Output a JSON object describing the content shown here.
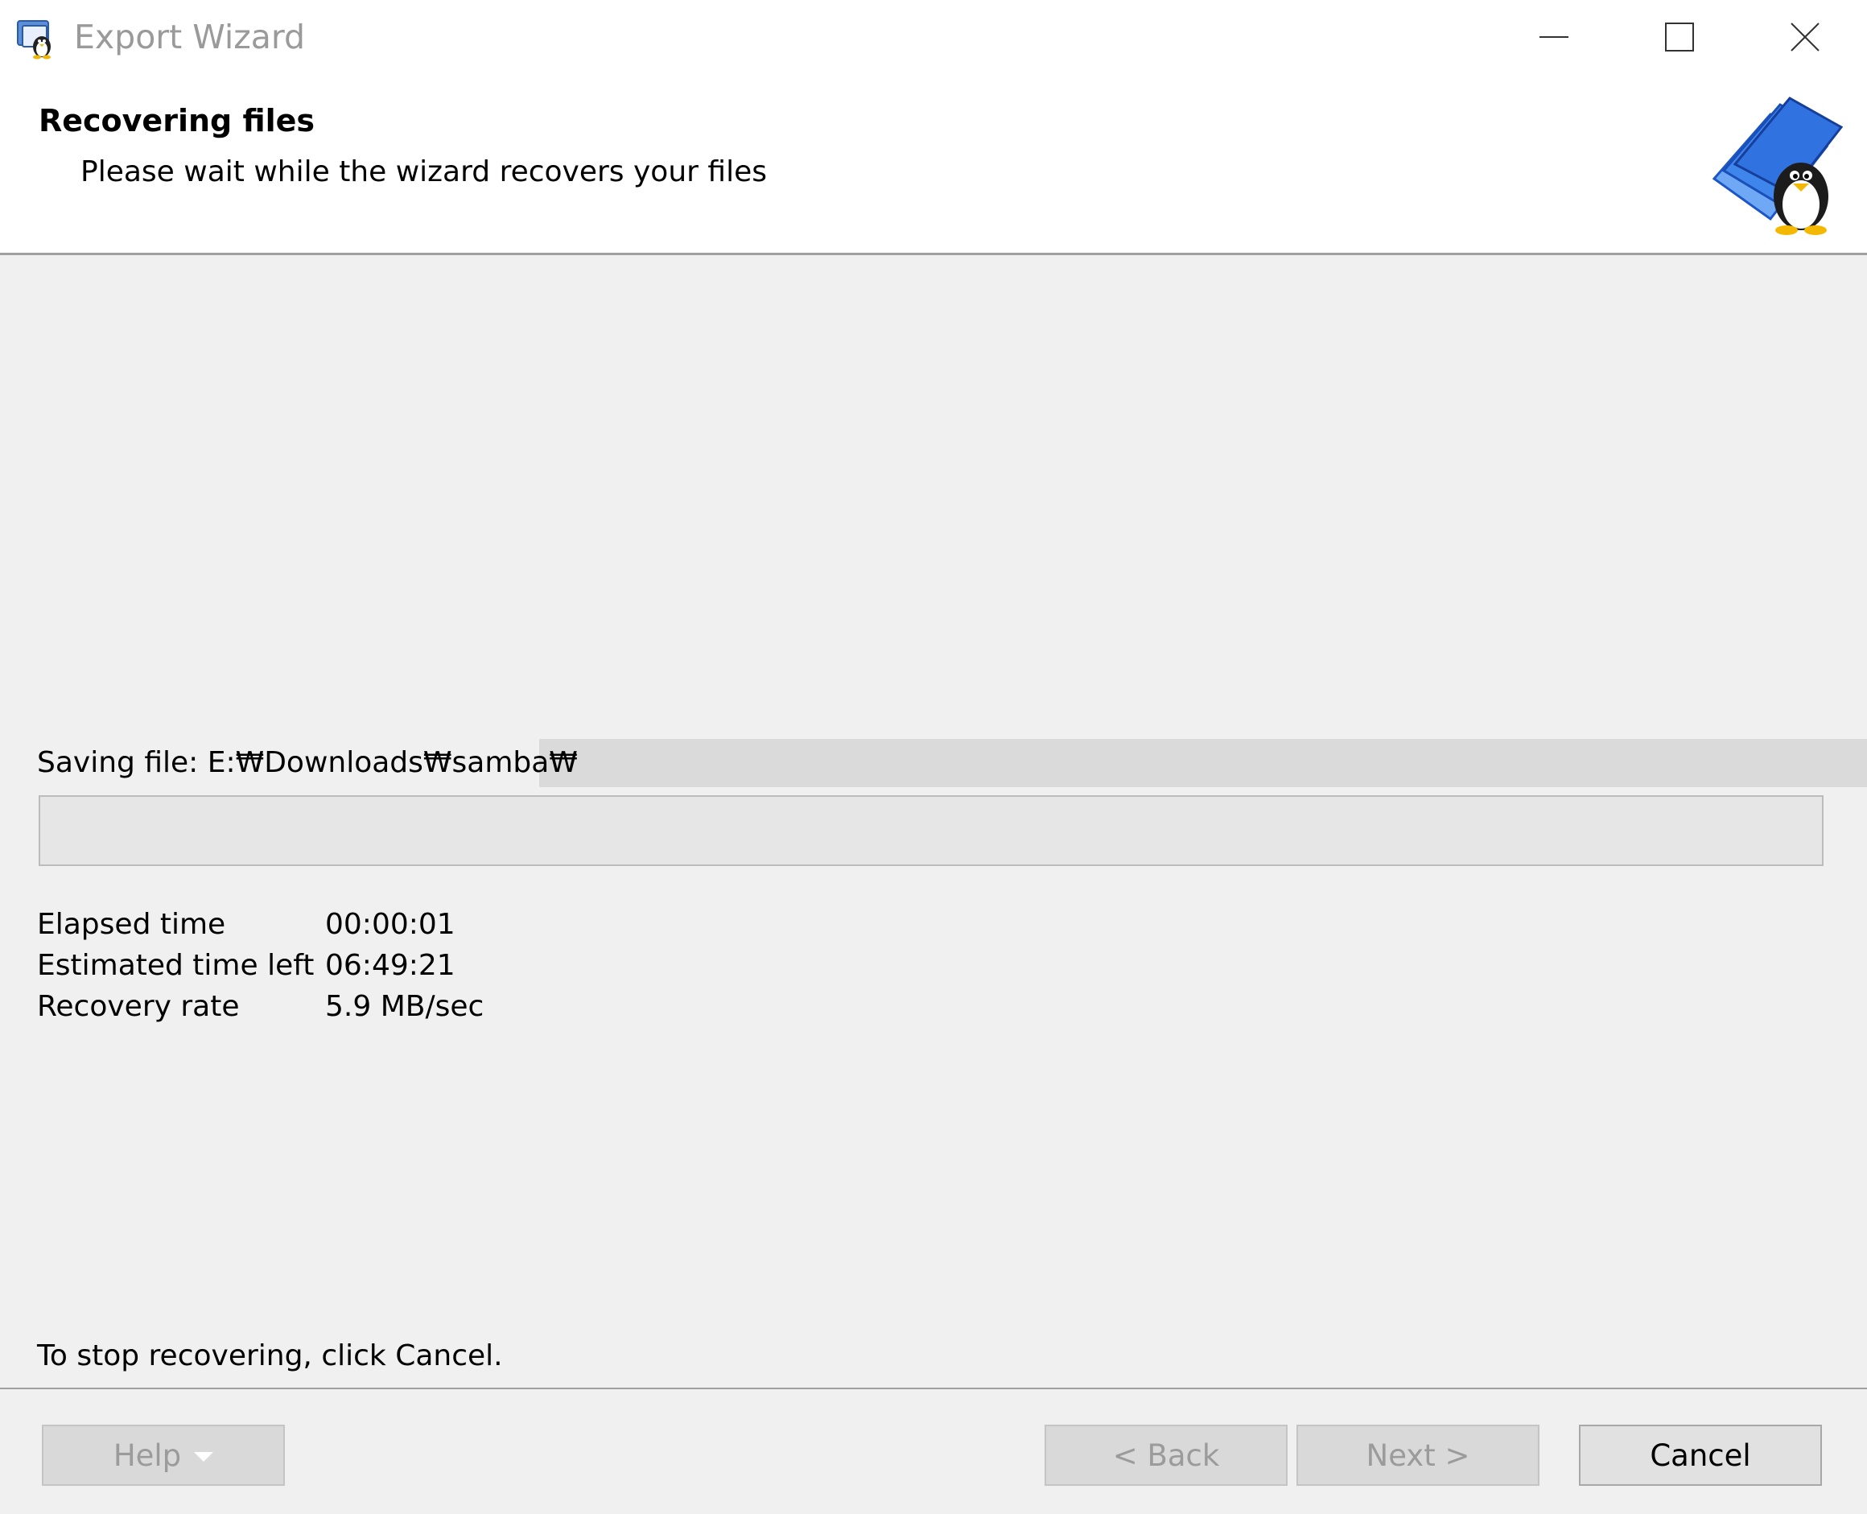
{
  "window": {
    "title": "Export Wizard",
    "icon": "wizard-penguin-icon",
    "controls": [
      "minimize-icon",
      "maximize-icon",
      "close-icon"
    ]
  },
  "header": {
    "title": "Recovering files",
    "subtitle": "Please wait while the wizard recovers your files",
    "logo": "folder-penguin-logo"
  },
  "progress": {
    "saving_label": "Saving file: E:₩Downloads₩samba₩",
    "fraction": 0.0
  },
  "stats": {
    "elapsed_label": "Elapsed time",
    "elapsed_value": "00:00:01",
    "remaining_label": "Estimated time left",
    "remaining_value": "06:49:21",
    "rate_label": "Recovery rate",
    "rate_value": "5.9 MB/sec"
  },
  "note": "To stop recovering, click Cancel.",
  "buttons": {
    "help": "Help",
    "back": "< Back",
    "next": "Next >",
    "cancel": "Cancel"
  }
}
